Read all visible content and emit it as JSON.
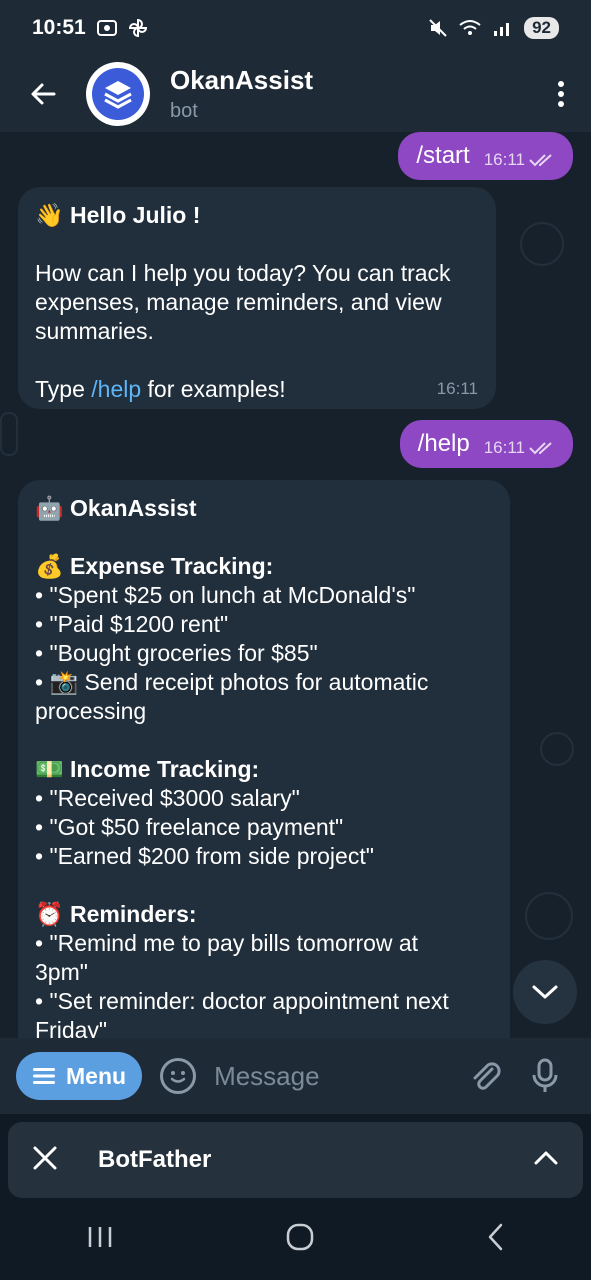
{
  "status": {
    "time": "10:51",
    "battery": "92"
  },
  "header": {
    "title": "OkanAssist",
    "subtitle": "bot"
  },
  "messages": [
    {
      "text": "/start",
      "time": "16:11"
    },
    {
      "lines": [
        "👋 Hello Julio !",
        "",
        "How can I help you today? You can track",
        "expenses, manage reminders, and view",
        "summaries.",
        "",
        "Type "
      ],
      "link": "/help",
      "link_suffix": " for examples!",
      "time": "16:11"
    },
    {
      "text": "/help",
      "time": "16:11"
    },
    {
      "lines": [
        "🤖 OkanAssist",
        "",
        "💰 Expense Tracking:",
        "• \"Spent $25 on lunch at McDonald's\"",
        "• \"Paid $1200 rent\"",
        "• \"Bought groceries for $85\"",
        "• 📸 Send receipt photos for automatic",
        "processing",
        "",
        "💵 Income Tracking:",
        "• \"Received $3000 salary\"",
        "• \"Got $50 freelance payment\"",
        "• \"Earned $200 from side project\"",
        "",
        "⏰ Reminders:",
        "• \"Remind me to pay bills tomorrow at",
        "3pm\"",
        "• \"Set reminder: doctor appointment next",
        "Friday\""
      ]
    }
  ],
  "input": {
    "menu_label": "Menu",
    "placeholder": "Message"
  },
  "bottom_panel": {
    "title": "BotFather"
  },
  "colors": {
    "outgoing": "#8f48c4",
    "incoming": "#212e3b",
    "link": "#5eb5f7",
    "menu": "#5b9fe0"
  }
}
